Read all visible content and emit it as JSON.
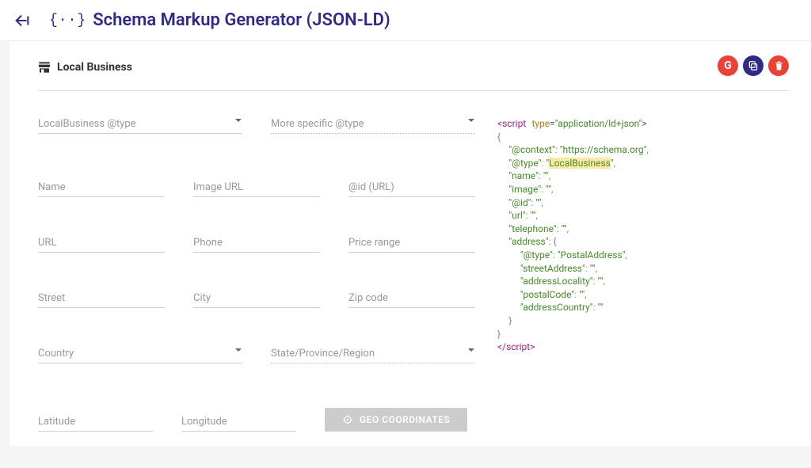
{
  "header": {
    "title": "Schema Markup Generator (JSON-LD)"
  },
  "section": {
    "title": "Local Business"
  },
  "actions": {
    "google_label": "G"
  },
  "form": {
    "type_placeholder": "LocalBusiness @type",
    "more_type_placeholder": "More specific @type",
    "name": "Name",
    "image": "Image URL",
    "id": "@id (URL)",
    "url": "URL",
    "phone": "Phone",
    "price_range": "Price range",
    "street": "Street",
    "city": "City",
    "zip": "Zip code",
    "country": "Country",
    "state": "State/Province/Region",
    "lat": "Latitude",
    "lon": "Longitude",
    "geo_button": "GEO COORDINATES"
  },
  "code": {
    "script_open_lt": "<",
    "script_tag": "script",
    "type_attr": "type",
    "type_val": "\"application/ld+json\"",
    "gt": ">",
    "lbrace": "{",
    "ctx_key": "\"@context\"",
    "ctx_val": "\"https://schema.org\"",
    "type_key": "\"@type\"",
    "type_val_pre": "\"",
    "type_val_hl": "LocalBusiness",
    "type_val_post": "\"",
    "name_key": "\"name\"",
    "empty": "\"\"",
    "image_key": "\"image\"",
    "id_key": "\"@id\"",
    "url_key": "\"url\"",
    "tel_key": "\"telephone\"",
    "addr_key": "\"address\"",
    "addr_type_key": "\"@type\"",
    "addr_type_val": "\"PostalAddress\"",
    "street_key": "\"streetAddress\"",
    "locality_key": "\"addressLocality\"",
    "postal_key": "\"postalCode\"",
    "country_key": "\"addressCountry\"",
    "rbrace": "}",
    "script_close": "</",
    "colon": ": ",
    "comma": ","
  }
}
